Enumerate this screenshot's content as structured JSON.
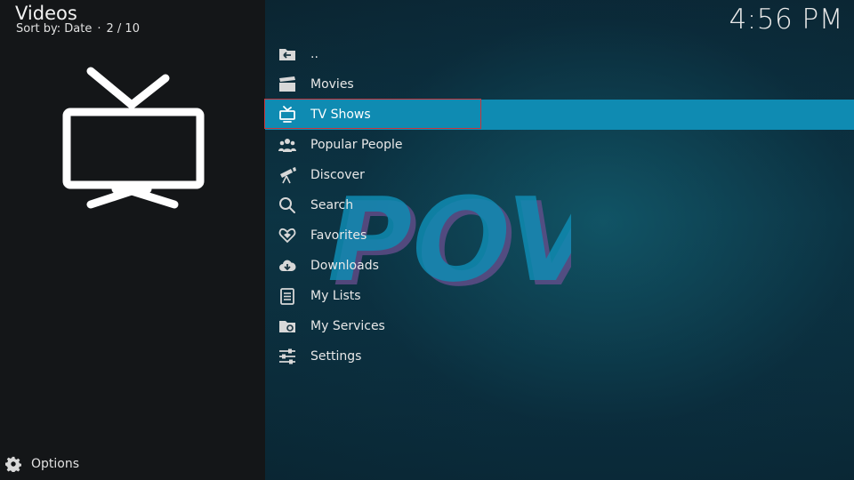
{
  "header": {
    "title": "Videos",
    "sort_label": "Sort by: Date",
    "position": "2 / 10"
  },
  "clock": "4:56 PM",
  "menu": {
    "items": [
      {
        "label": "..",
        "icon": "folder-up-icon"
      },
      {
        "label": "Movies",
        "icon": "clapperboard-icon"
      },
      {
        "label": "TV Shows",
        "icon": "tv-icon",
        "selected": true
      },
      {
        "label": "Popular People",
        "icon": "people-icon"
      },
      {
        "label": "Discover",
        "icon": "telescope-icon"
      },
      {
        "label": "Search",
        "icon": "search-icon"
      },
      {
        "label": "Favorites",
        "icon": "heart-icon"
      },
      {
        "label": "Downloads",
        "icon": "cloud-download-icon"
      },
      {
        "label": "My Lists",
        "icon": "list-icon"
      },
      {
        "label": "My Services",
        "icon": "folder-icon"
      },
      {
        "label": "Settings",
        "icon": "sliders-icon"
      }
    ]
  },
  "footer": {
    "options_label": "Options",
    "icon": "gear-icon"
  },
  "watermark_text": "POV",
  "colors": {
    "selected_bg": "#0f8bb2",
    "focus_border": "#c9343a",
    "watermark_fill": "#0f8bb2",
    "watermark_shadow": "#6a4f8f"
  }
}
